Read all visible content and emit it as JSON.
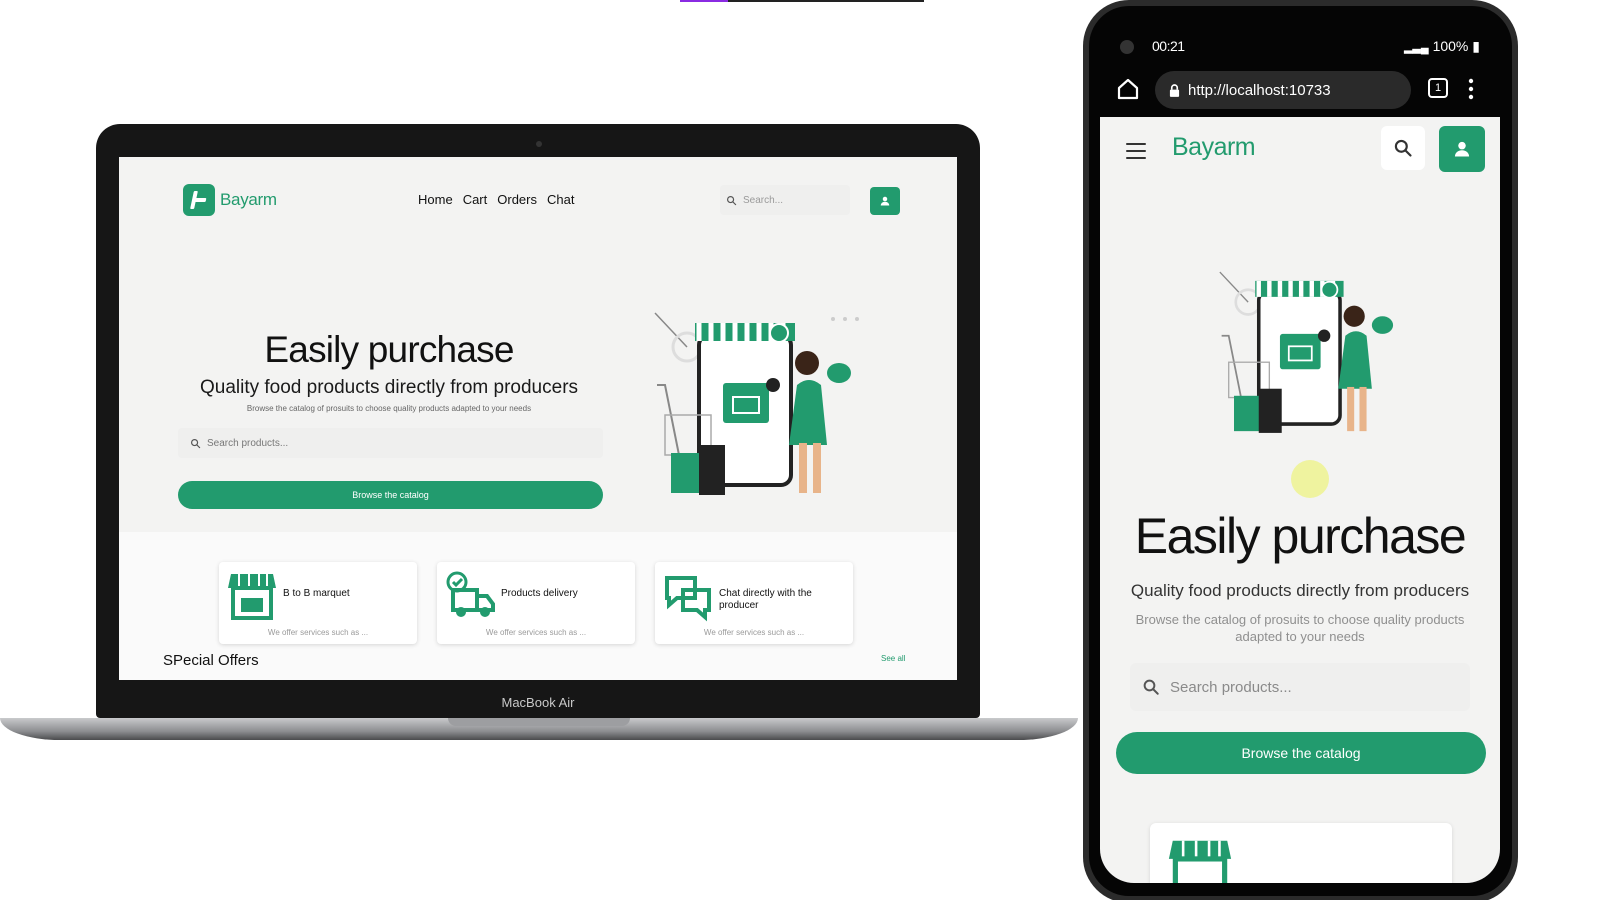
{
  "brand": {
    "name": "Bayarm",
    "accent": "#229b6e"
  },
  "desktop": {
    "device_label": "MacBook Air",
    "nav": {
      "links": [
        "Home",
        "Cart",
        "Orders",
        "Chat"
      ],
      "search_placeholder": "Search..."
    },
    "hero": {
      "title": "Easily purchase",
      "subtitle": "Quality food products directly from producers",
      "description": "Browse the catalog of prosuits to choose quality products adapted to your needs",
      "search_placeholder": "Search products...",
      "cta": "Browse the catalog"
    },
    "services": [
      {
        "title": "B to B marquet",
        "subtitle": "We offer services such as ...",
        "icon": "store-icon"
      },
      {
        "title": "Products delivery",
        "subtitle": "We offer services such as ...",
        "icon": "delivery-truck-icon"
      },
      {
        "title": "Chat directly with the producer",
        "subtitle": "We offer services such as ...",
        "icon": "chat-bubbles-icon"
      }
    ],
    "offers": {
      "title": "SPecial Offers",
      "see_all": "See all"
    }
  },
  "mobile": {
    "status": {
      "time": "00:21",
      "battery": "100%"
    },
    "browser": {
      "url": "http://localhost:10733",
      "tab_count": "1"
    },
    "hero": {
      "title": "Easily purchase",
      "subtitle": "Quality food products directly from producers",
      "description": "Browse the catalog of prosuits to choose quality products adapted to your needs",
      "search_placeholder": "Search products...",
      "cta": "Browse the catalog"
    }
  }
}
